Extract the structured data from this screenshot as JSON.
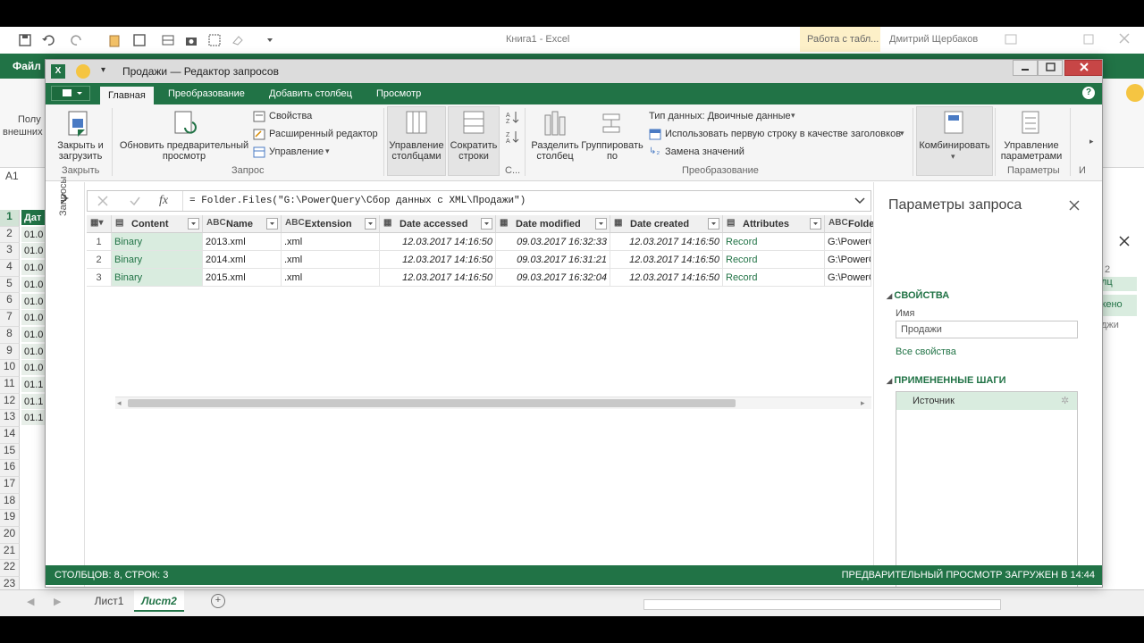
{
  "excel": {
    "title": "Книга1 - Excel",
    "context_tab": "Работа с табл...",
    "user": "Дмитрий Щербаков",
    "file_tab": "Файл",
    "ribbon_left": [
      "Полу",
      "внешних"
    ],
    "namebox": "A1",
    "rows": [
      "1",
      "2",
      "3",
      "4",
      "5",
      "6",
      "7",
      "8",
      "9",
      "10",
      "11",
      "12",
      "13",
      "14",
      "15",
      "16",
      "17",
      "18",
      "19",
      "20",
      "21",
      "22",
      "23"
    ],
    "cells": [
      "Дат",
      "01.0",
      "01.0",
      "01.0",
      "01.0",
      "01.0",
      "01.0",
      "01.0",
      "01.0",
      "01.0",
      "01.1",
      "01.1",
      "01.1"
    ],
    "right_frags": [
      "2",
      "лц",
      "жено",
      "джи"
    ],
    "sheets": [
      "Лист1",
      "Лист2"
    ]
  },
  "pq": {
    "title": "Продажи — Редактор запросов",
    "tabs": [
      "Главная",
      "Преобразование",
      "Добавить столбец",
      "Просмотр"
    ],
    "ribbon": {
      "close_load": "Закрыть и загрузить",
      "refresh_preview": "Обновить предварительный просмотр",
      "properties": "Свойства",
      "advanced_editor": "Расширенный редактор",
      "manage": "Управление",
      "manage_columns": "Управление столбцами",
      "reduce_rows": "Сократить строки",
      "split_column": "Разделить столбец",
      "group_by": "Группировать по",
      "data_type": "Тип данных: Двоичные данные",
      "first_row_headers": "Использовать первую строку в качестве заголовков",
      "replace_values": "Замена значений",
      "combine": "Комбинировать",
      "manage_params": "Управление параметрами",
      "group_close": "Закрыть",
      "group_query": "Запрос",
      "group_sort": "С...",
      "group_transform": "Преобразование",
      "group_params": "Параметры",
      "group_more": "И"
    },
    "nav_label": "Запросы",
    "formula": "= Folder.Files(\"G:\\PowerQuery\\Сбор данных с XML\\Продажи\")",
    "columns": [
      "Content",
      "Name",
      "Extension",
      "Date accessed",
      "Date modified",
      "Date created",
      "Attributes",
      "Folder"
    ],
    "column_types": [
      "▤",
      "ABC",
      "ABC",
      "▦",
      "▦",
      "▦",
      "▤",
      "ABC"
    ],
    "rows": [
      {
        "n": "1",
        "content": "Binary",
        "name": "2013.xml",
        "ext": ".xml",
        "accessed": "12.03.2017 14:16:50",
        "modified": "09.03.2017 16:32:33",
        "created": "12.03.2017 14:16:50",
        "attributes": "Record",
        "folder": "G:\\PowerC"
      },
      {
        "n": "2",
        "content": "Binary",
        "name": "2014.xml",
        "ext": ".xml",
        "accessed": "12.03.2017 14:16:50",
        "modified": "09.03.2017 16:31:21",
        "created": "12.03.2017 14:16:50",
        "attributes": "Record",
        "folder": "G:\\PowerC"
      },
      {
        "n": "3",
        "content": "Binary",
        "name": "2015.xml",
        "ext": ".xml",
        "accessed": "12.03.2017 14:16:50",
        "modified": "09.03.2017 16:32:04",
        "created": "12.03.2017 14:16:50",
        "attributes": "Record",
        "folder": "G:\\PowerC"
      }
    ],
    "settings": {
      "title": "Параметры запроса",
      "props_header": "СВОЙСТВА",
      "name_label": "Имя",
      "name_value": "Продажи",
      "all_props": "Все свойства",
      "steps_header": "ПРИМЕНЕННЫЕ ШАГИ",
      "steps": [
        "Источник"
      ]
    },
    "status_left": "СТОЛБЦОВ: 8, СТРОК: 3",
    "status_right": "ПРЕДВАРИТЕЛЬНЫЙ ПРОСМОТР ЗАГРУЖЕН В 14:44",
    "colors": {
      "accent": "#217346",
      "selected": "#d9ecdf"
    }
  }
}
